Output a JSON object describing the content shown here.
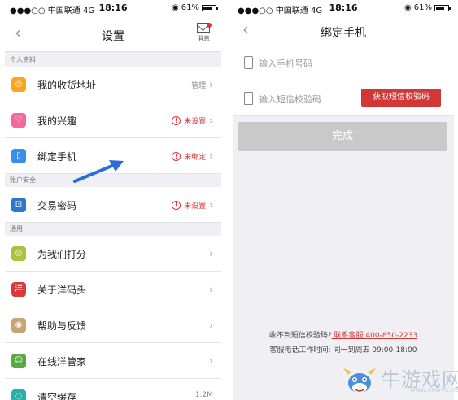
{
  "left": {
    "statusbar": {
      "carrier": "●●●○○ 中国联通  4G",
      "time": "18:16",
      "battery": "61%",
      "battery_level": 0.61
    },
    "navbar": {
      "back": "‹",
      "title": "设置",
      "msg_label": "消息"
    },
    "sections": [
      {
        "header": "个人资料",
        "rows": [
          {
            "label": "我的收货地址",
            "icon": "location-icon",
            "color": "#f5a623",
            "glyph": "◎",
            "right": "管理",
            "style": "grey"
          },
          {
            "label": "我的兴趣",
            "icon": "heart-icon",
            "color": "#f06a9b",
            "glyph": "♡",
            "right": "未设置",
            "style": "warn"
          },
          {
            "label": "绑定手机",
            "icon": "phone-icon",
            "color": "#3a8ee6",
            "glyph": "▯",
            "right": "未绑定",
            "style": "warn"
          }
        ]
      },
      {
        "header": "账户安全",
        "rows": [
          {
            "label": "交易密码",
            "icon": "lock-icon",
            "color": "#2e79c7",
            "glyph": "⊡",
            "right": "未设置",
            "style": "warn"
          }
        ]
      },
      {
        "header": "通用",
        "rows": [
          {
            "label": "为我们打分",
            "icon": "rate-icon",
            "color": "#a8c43a",
            "glyph": "◎",
            "right": "",
            "style": "grey"
          },
          {
            "label": "关于洋码头",
            "icon": "about-icon",
            "color": "#d93a3a",
            "glyph": "洋",
            "right": "",
            "style": "grey"
          },
          {
            "label": "帮助与反馈",
            "icon": "help-icon",
            "color": "#c8a472",
            "glyph": "◉",
            "right": "",
            "style": "grey"
          },
          {
            "label": "在线洋管家",
            "icon": "service-icon",
            "color": "#5aa846",
            "glyph": "☺",
            "right": "",
            "style": "grey"
          },
          {
            "label": "清空缓存",
            "icon": "cache-icon",
            "color": "#2bb0a8",
            "glyph": "◌",
            "right": "1.2M",
            "style": "grey"
          }
        ]
      }
    ]
  },
  "right": {
    "statusbar": {
      "carrier": "●●●○○ 中国联通  4G",
      "time": "18:16",
      "battery": "61%",
      "battery_level": 0.61
    },
    "navbar": {
      "back": "‹",
      "title": "绑定手机"
    },
    "phone_placeholder": "输入手机号码",
    "code_placeholder": "输入短信校验码",
    "get_code_button": "获取短信校验码",
    "done_button": "完成",
    "help_line1_prefix": "收不到短信校验码?",
    "help_line1_link": " 联系客服 400-850-2233",
    "help_line2": "客服电话工作时间: 同一到周五 09:00-18:00"
  },
  "watermark": {
    "text": "牛游戏网",
    "url": "www.newyx.net"
  }
}
